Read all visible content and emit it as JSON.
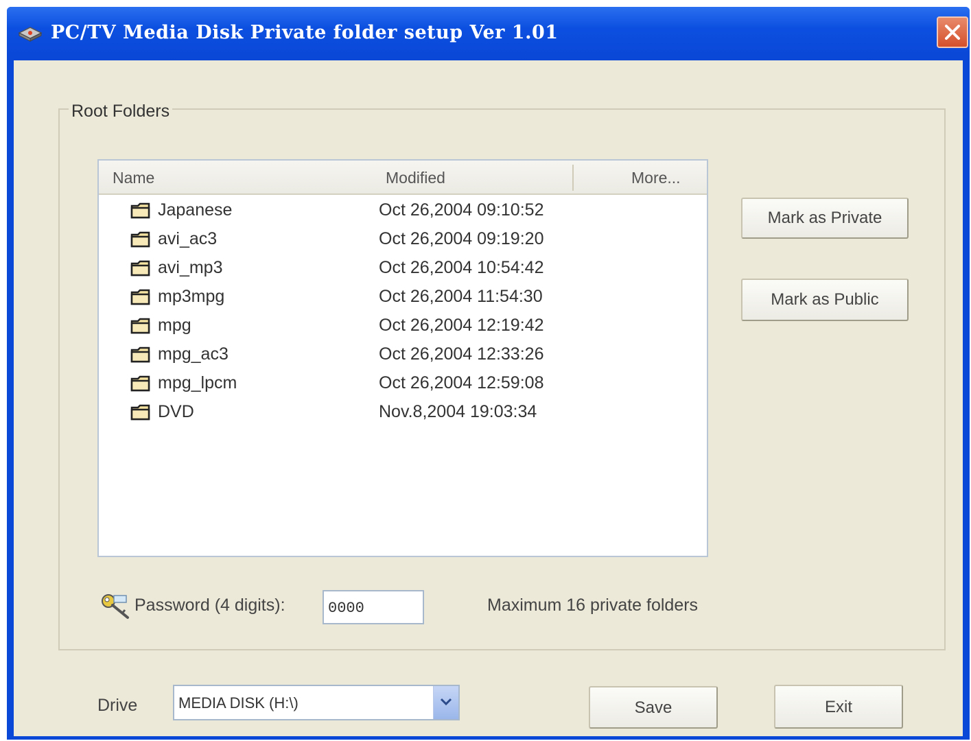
{
  "window": {
    "title": "PC/TV Media Disk Private folder setup Ver 1.01"
  },
  "group": {
    "label": "Root Folders"
  },
  "list": {
    "columns": [
      "Name",
      "Modified",
      "More..."
    ],
    "rows": [
      {
        "name": "Japanese",
        "modified": "Oct 26,2004 09:10:52"
      },
      {
        "name": "avi_ac3",
        "modified": "Oct 26,2004 09:19:20"
      },
      {
        "name": "avi_mp3",
        "modified": "Oct 26,2004 10:54:42"
      },
      {
        "name": "mp3mpg",
        "modified": "Oct 26,2004 11:54:30"
      },
      {
        "name": "mpg",
        "modified": "Oct 26,2004 12:19:42"
      },
      {
        "name": "mpg_ac3",
        "modified": "Oct 26,2004 12:33:26"
      },
      {
        "name": "mpg_lpcm",
        "modified": "Oct 26,2004 12:59:08"
      },
      {
        "name": "DVD",
        "modified": "Nov.8,2004 19:03:34"
      }
    ]
  },
  "buttons": {
    "mark_private": "Mark as Private",
    "mark_public": "Mark as Public",
    "save": "Save",
    "exit": "Exit"
  },
  "password": {
    "label": "Password (4 digits):",
    "value": "0000"
  },
  "info": {
    "max_text": "Maximum 16 private folders"
  },
  "drive": {
    "label": "Drive",
    "value": "MEDIA DISK (H:\\)"
  },
  "colors": {
    "titlebar": "#0a48d8",
    "client_bg": "#ece9d8",
    "close_button": "#d4502c"
  },
  "icons": {
    "app": "disk-app-icon",
    "close": "close-icon",
    "folder": "folder-icon",
    "key": "key-icon",
    "dropdown": "chevron-down-icon"
  }
}
